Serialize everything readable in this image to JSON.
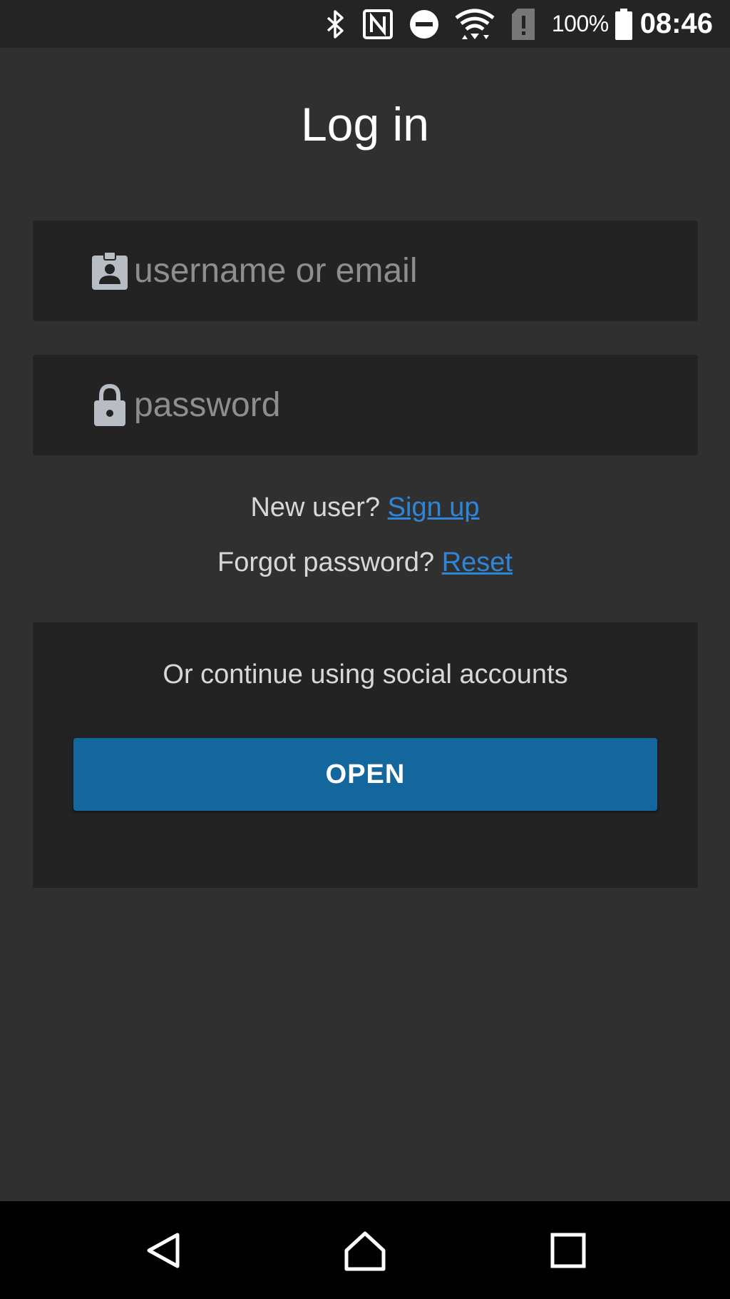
{
  "status_bar": {
    "icons": [
      "bluetooth-icon",
      "nfc-icon",
      "do-not-disturb-icon",
      "wifi-icon",
      "sim-alert-icon",
      "battery-icon"
    ],
    "battery_percent": "100%",
    "time": "08:46"
  },
  "page": {
    "title": "Log in"
  },
  "form": {
    "username_placeholder": "username or email",
    "username_icon": "contact-badge-icon",
    "password_placeholder": "password",
    "password_icon": "lock-icon"
  },
  "links": {
    "new_user_prompt": "New user?",
    "sign_up_label": "Sign up",
    "forgot_prompt": "Forgot password?",
    "reset_label": "Reset"
  },
  "social": {
    "heading": "Or continue using social accounts",
    "open_button_label": "OPEN"
  },
  "nav_bar": {
    "icons": [
      "back-icon",
      "home-icon",
      "recents-icon"
    ]
  },
  "colors": {
    "background": "#303030",
    "panel": "#232323",
    "link": "#2f86d8",
    "button": "#13679d"
  }
}
